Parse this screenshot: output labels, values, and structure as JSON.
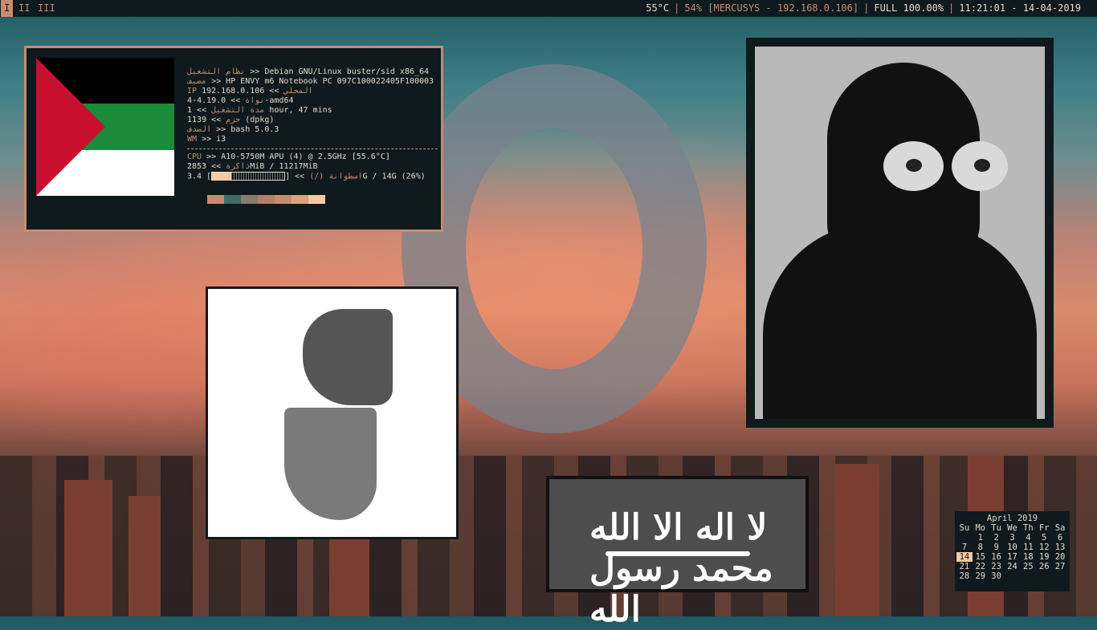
{
  "topbar": {
    "workspaces": [
      {
        "label": "I",
        "active": true
      },
      {
        "label": "II",
        "active": false
      },
      {
        "label": "III",
        "active": false
      }
    ],
    "temperature": "55°C",
    "wifi": "54% [MERCUSYS - 192.168.0.106]",
    "battery": "FULL 100.00%",
    "clock": "11:21:01 - 14-04-2019"
  },
  "neofetch": {
    "rows": [
      {
        "key": "نظام التشغيل",
        "value": ">> Debian GNU/Linux buster/sid x86_64"
      },
      {
        "key": "مضيف",
        "value": ">> HP ENVY m6 Notebook PC 097C100022405F100003"
      },
      {
        "key": "IP المحلي",
        "value": ">> 192.168.0.106"
      },
      {
        "key": "نواة",
        "value": ">> 4.19.0-4-amd64"
      },
      {
        "key": "مدة التشغيل",
        "value": ">> 1 hour, 47 mins"
      },
      {
        "key": "حزم",
        "value": ">> 1139 (dpkg)"
      },
      {
        "key": "الصدف",
        "value": ">> bash 5.0.3"
      },
      {
        "key": "WM",
        "value": ">> i3"
      }
    ],
    "hw_rows": [
      {
        "key": "CPU",
        "value": ">> A10-5750M APU (4) @ 2.5GHz [55.6°C]"
      },
      {
        "key": "ذاكرة",
        "value": ">> 2853MiB / 11217MiB"
      }
    ],
    "disk": {
      "key": "اسطوانة (/)",
      "prefix": ">> [",
      "suffix": "] 3.4G / 14G (26%)",
      "fraction": 0.26
    },
    "swatches": [
      "#c98a70",
      "#3f6b6b",
      "#8a7a6a",
      "#b08068",
      "#c98a70",
      "#e0a07a",
      "#f6c9a0"
    ]
  },
  "calendar": {
    "title": "April 2019",
    "weekdays": [
      "Su",
      "Mo",
      "Tu",
      "We",
      "Th",
      "Fr",
      "Sa"
    ],
    "weeks": [
      [
        "",
        "1",
        "2",
        "3",
        "4",
        "5",
        "6"
      ],
      [
        "7",
        "8",
        "9",
        "10",
        "11",
        "12",
        "13"
      ],
      [
        "14",
        "15",
        "16",
        "17",
        "18",
        "19",
        "20"
      ],
      [
        "21",
        "22",
        "23",
        "24",
        "25",
        "26",
        "27"
      ],
      [
        "28",
        "29",
        "30",
        "",
        "",
        "",
        ""
      ]
    ],
    "today": "14"
  },
  "banner": {
    "text": "لا اله الا الله محمد رسول الله"
  },
  "colors": {
    "accent": "#c98a70",
    "bar_bg": "#0e1a1d",
    "fg": "#e8d8c8",
    "highlight": "#f6c9a0"
  }
}
